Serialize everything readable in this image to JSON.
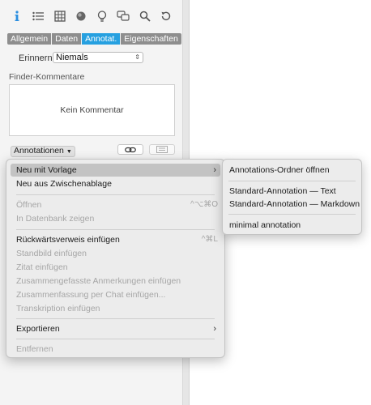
{
  "toolbar": {
    "icons": [
      "info-icon",
      "list-icon",
      "grid-icon",
      "circle-icon",
      "lightbulb-icon",
      "chat-icon",
      "search-icon",
      "history-icon"
    ],
    "active_color": "#2a8ee0"
  },
  "tabs": [
    {
      "label": "Allgemein"
    },
    {
      "label": "Daten"
    },
    {
      "label": "Annotat.",
      "active": true
    },
    {
      "label": "Eigenschaften"
    }
  ],
  "remind": {
    "label": "Erinnern",
    "value": "Niemals"
  },
  "finder": {
    "title": "Finder-Kommentare",
    "placeholder": "Kein Kommentar"
  },
  "annotations_button": {
    "label": "Annotationen"
  },
  "main_menu": {
    "items": [
      {
        "label": "Neu mit Vorlage",
        "highlighted": true,
        "submenu": true
      },
      {
        "label": "Neu aus Zwischenablage"
      },
      {
        "label": "Öffnen",
        "disabled": true,
        "shortcut": "^⌥⌘O"
      },
      {
        "label": "In Datenbank zeigen",
        "disabled": true
      },
      {
        "label": "Rückwärtsverweis einfügen",
        "shortcut": "^⌘L"
      },
      {
        "label": "Standbild einfügen",
        "disabled": true
      },
      {
        "label": "Zitat einfügen",
        "disabled": true
      },
      {
        "label": "Zusammengefasste Anmerkungen einfügen",
        "disabled": true
      },
      {
        "label": "Zusammenfassung per Chat einfügen...",
        "disabled": true
      },
      {
        "label": "Transkription einfügen",
        "disabled": true
      },
      {
        "label": "Exportieren",
        "submenu": true
      },
      {
        "label": "Entfernen",
        "disabled": true
      }
    ]
  },
  "sub_menu": {
    "items": [
      {
        "label": "Annotations-Ordner öffnen"
      },
      {
        "label": "Standard-Annotation — Text"
      },
      {
        "label": "Standard-Annotation — Markdown"
      },
      {
        "label": "minimal annotation"
      }
    ]
  }
}
